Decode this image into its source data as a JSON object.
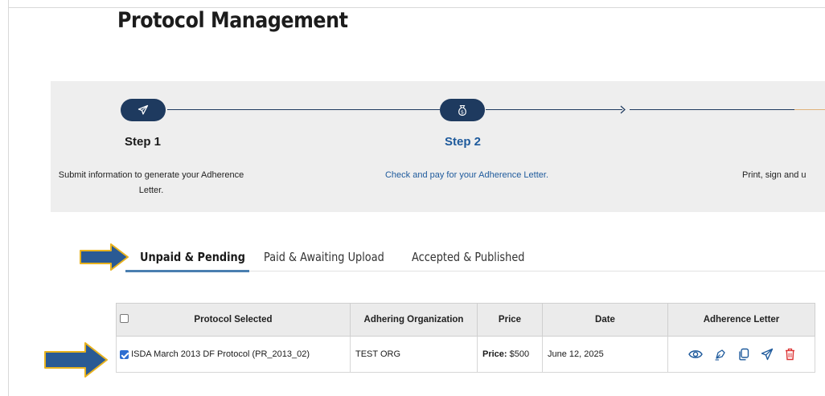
{
  "page": {
    "title": "Protocol Management"
  },
  "stepper": {
    "steps": [
      {
        "label": "Step 1",
        "description": "Submit information to generate your Adherence Letter.",
        "icon": "paper-plane-icon"
      },
      {
        "label": "Step 2",
        "description": "Check and pay for your Adherence Letter.",
        "icon": "money-bag-icon"
      },
      {
        "label": "",
        "description": "Print, sign and u",
        "icon": ""
      }
    ],
    "colors": {
      "pill": "#1e3a5f",
      "active_text": "#1e5a9c",
      "connector": "#1e3a5f",
      "pending_connector": "#e0b27a"
    }
  },
  "tabs": [
    {
      "label": "Unpaid & Pending",
      "active": true
    },
    {
      "label": "Paid & Awaiting Upload",
      "active": false
    },
    {
      "label": "Accepted & Published",
      "active": false
    }
  ],
  "table": {
    "headers": [
      "Protocol Selected",
      "Adhering Organization",
      "Price",
      "Date",
      "Adherence Letter"
    ],
    "rows": [
      {
        "checked": true,
        "protocol": "ISDA March 2013 DF Protocol (PR_2013_02)",
        "organization": "TEST ORG",
        "price_label": "Price:",
        "price_value": "$500",
        "date": "June 12, 2025",
        "actions": [
          "eye-icon",
          "sign-pen-icon",
          "copy-icon",
          "send-icon",
          "trash-icon"
        ]
      }
    ]
  },
  "callouts": {
    "color": "#2a5a94",
    "border": "#e8b21e"
  }
}
